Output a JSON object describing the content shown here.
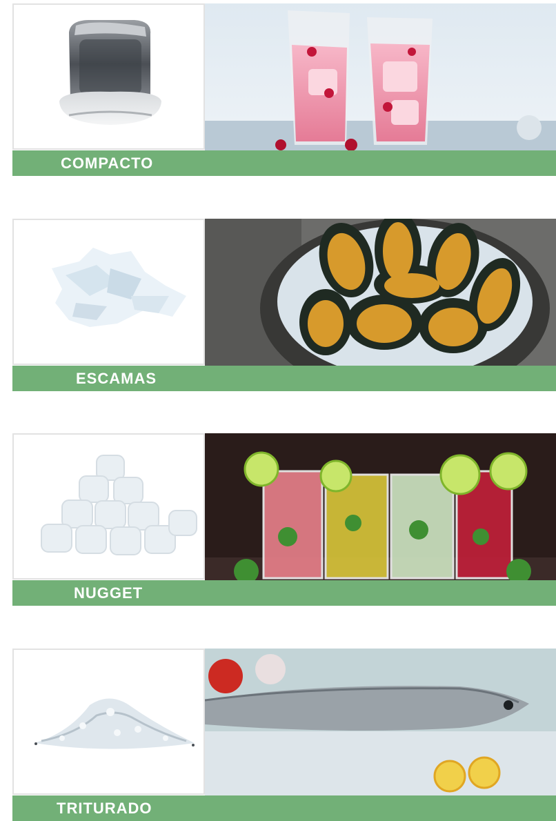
{
  "colors": {
    "label_bar": "#72b077",
    "label_text": "#ffffff",
    "thumb_border": "#e2e2e2"
  },
  "ice_types": [
    {
      "label": "COMPACTO",
      "thumb": "compact-ice-cube-image",
      "photo": "pink-cranberry-drinks-photo"
    },
    {
      "label": "ESCAMAS",
      "thumb": "flake-ice-image",
      "photo": "mussels-on-ice-photo"
    },
    {
      "label": "NUGGET",
      "thumb": "nugget-ice-image",
      "photo": "mojito-cocktails-photo"
    },
    {
      "label": "TRITURADO",
      "thumb": "crushed-ice-pile-image",
      "photo": "fish-on-crushed-ice-photo"
    }
  ]
}
